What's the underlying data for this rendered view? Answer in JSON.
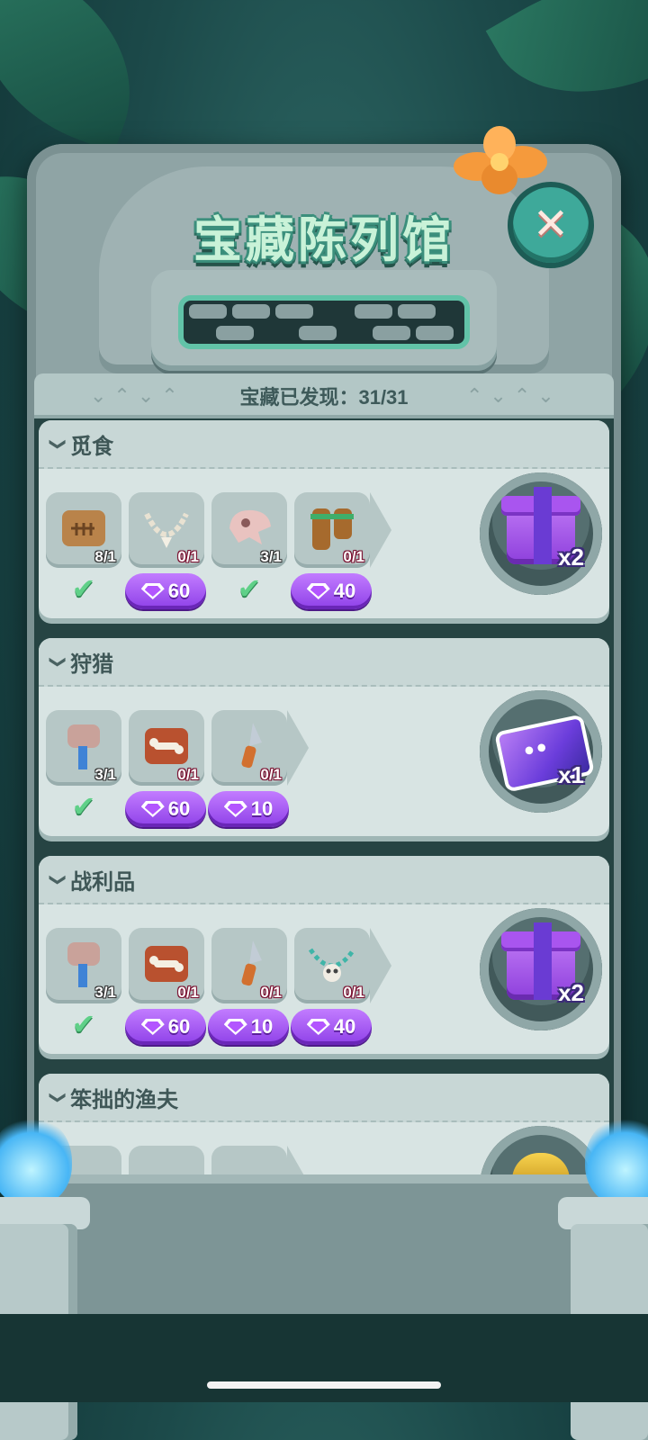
{
  "title": "宝藏陈列馆",
  "counter": {
    "label": "宝藏已发现：",
    "value": "31/31"
  },
  "close_symbol": "✕",
  "categories": [
    {
      "name": "觅食",
      "items": [
        {
          "icon": "fossil-tablet-icon",
          "count": "8/1",
          "status": "collected"
        },
        {
          "icon": "bone-necklace-icon",
          "count": "0/1",
          "price": "60"
        },
        {
          "icon": "animal-skull-icon",
          "count": "3/1",
          "status": "collected"
        },
        {
          "icon": "wooden-binoculars-icon",
          "count": "0/1",
          "price": "40"
        }
      ],
      "reward": {
        "icon": "purple-gift-box-icon",
        "multiplier": "x2"
      }
    },
    {
      "name": "狩猎",
      "items": [
        {
          "icon": "stone-hammer-icon",
          "count": "3/1",
          "status": "collected"
        },
        {
          "icon": "bone-on-slab-icon",
          "count": "0/1",
          "price": "60"
        },
        {
          "icon": "stone-spear-tip-icon",
          "count": "0/1",
          "price": "10"
        }
      ],
      "reward": {
        "icon": "mickey-ticket-icon",
        "multiplier": "x1"
      }
    },
    {
      "name": "战利品",
      "items": [
        {
          "icon": "stone-hammer-icon",
          "count": "3/1",
          "status": "collected"
        },
        {
          "icon": "bone-on-slab-icon",
          "count": "0/1",
          "price": "60"
        },
        {
          "icon": "stone-spear-tip-icon",
          "count": "0/1",
          "price": "10"
        },
        {
          "icon": "skull-necklace-icon",
          "count": "0/1",
          "price": "40"
        }
      ],
      "reward": {
        "icon": "purple-gift-box-icon",
        "multiplier": "x2"
      }
    },
    {
      "name": "笨拙的渔夫",
      "items": [],
      "reward": {
        "icon": "gold-coins-icon",
        "multiplier": ""
      }
    }
  ],
  "colors": {
    "accent": "#3ea99a",
    "gem_button": "#9b4ff0",
    "check": "#5fd088",
    "count_red": "#7a1030"
  }
}
